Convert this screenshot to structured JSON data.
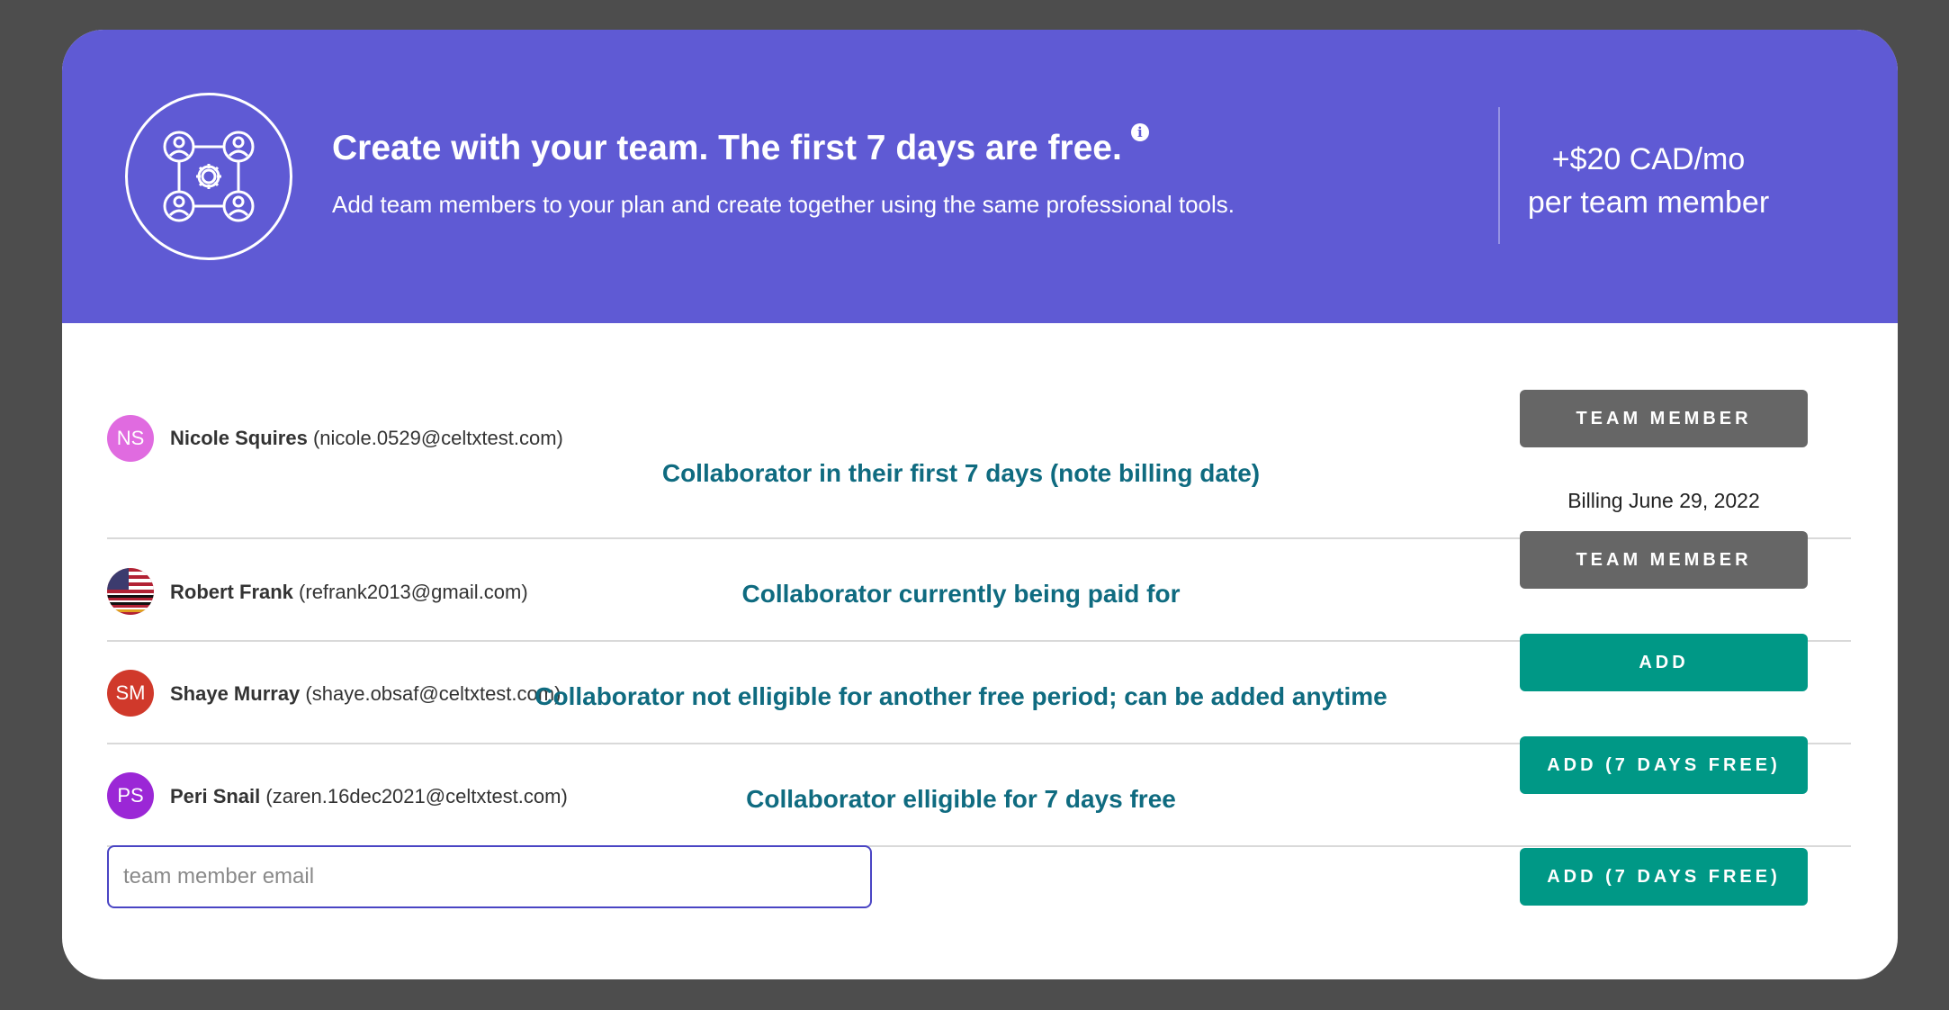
{
  "banner": {
    "title": "Create with your team. The first 7 days are free.",
    "info_icon": "info-icon",
    "subtitle": "Add team members to your plan and create together using the same professional tools.",
    "price_line1": "+$20 CAD/mo",
    "price_line2": "per team member",
    "color": "#5f5ad4"
  },
  "members": [
    {
      "initials": "NS",
      "avatar_color": "#e06be0",
      "name": "Nicole Squires",
      "email": "(nicole.0529@celtxtest.com)",
      "note": "Collaborator in their first 7 days (note billing date)",
      "button": "TEAM MEMBER",
      "billing": "Billing June 29, 2022"
    },
    {
      "initials": "",
      "avatar_icon": "us-flag-avatar",
      "name": "Robert Frank",
      "email": "(refrank2013@gmail.com)",
      "note": "Collaborator currently being paid for",
      "button": "TEAM MEMBER"
    },
    {
      "initials": "SM",
      "avatar_color": "#d0392b",
      "name": "Shaye Murray",
      "email": "(shaye.obsaf@celtxtest.com)",
      "note": "Collaborator not elligible for another free period; can be added anytime",
      "button": "ADD"
    },
    {
      "initials": "PS",
      "avatar_color": "#9b27d6",
      "name": "Peri Snail",
      "email": "(zaren.16dec2021@celtxtest.com)",
      "note": "Collaborator elligible for 7 days free",
      "button": "ADD (7 DAYS FREE)"
    }
  ],
  "add_form": {
    "placeholder": "team member email",
    "value": "",
    "button": "ADD (7 DAYS FREE)"
  },
  "colors": {
    "teal": "#009886",
    "grey": "#666666",
    "note_text": "#0f6b80"
  }
}
